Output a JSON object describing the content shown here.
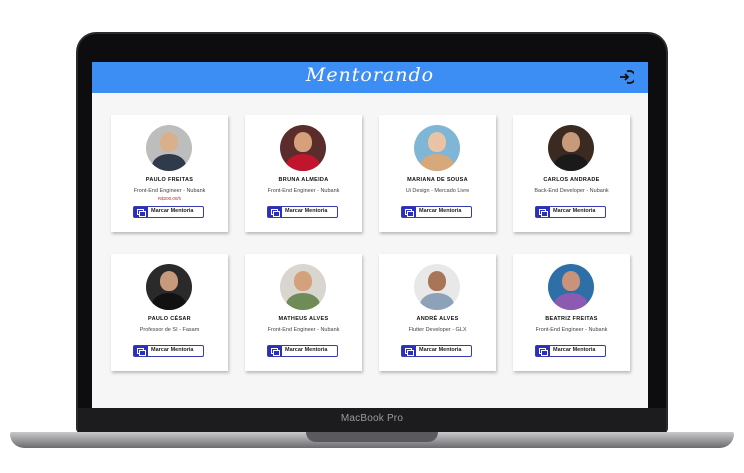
{
  "device": {
    "label": "MacBook Pro"
  },
  "app": {
    "title": "Mentorando"
  },
  "mentors": [
    {
      "name": "PAULO FREITAS",
      "role": "Front-End Engineer - Nubank",
      "price": "R$200,00/h",
      "button": "Marcar Mentoria",
      "bg": "#bdbdbd",
      "skin": "#d9b08c",
      "shirt": "#2f3a4a"
    },
    {
      "name": "BRUNA ALMEIDA",
      "role": "Front-End Engineer - Nubank",
      "button": "Marcar Mentoria",
      "bg": "#5b2c2c",
      "skin": "#d6a07a",
      "shirt": "#c0152c"
    },
    {
      "name": "MARIANA DE SOUSA",
      "role": "Ui Design - Mercado Livre",
      "button": "Marcar Mentoria",
      "bg": "#7fb6d6",
      "skin": "#e9c3a3",
      "shirt": "#d7a97a"
    },
    {
      "name": "CARLOS ANDRADE",
      "role": "Back-End Developer - Nubank",
      "button": "Marcar Mentoria",
      "bg": "#3b2a22",
      "skin": "#c79a7a",
      "shirt": "#1a1a1a"
    },
    {
      "name": "PAULO CÉSAR",
      "role": "Professor de SI - Fasam",
      "button": "Marcar Mentoria",
      "bg": "#2a2a2a",
      "skin": "#c89a7c",
      "shirt": "#111111"
    },
    {
      "name": "MATHEUS ALVES",
      "role": "Front-End Engineer - Nubank",
      "button": "Marcar Mentoria",
      "bg": "#d9d5cf",
      "skin": "#d4a17d",
      "shirt": "#6f8b57"
    },
    {
      "name": "ANDRÉ ALVES",
      "role": "Flutter Developer - GLX",
      "button": "Marcar Mentoria",
      "bg": "#e8e8e8",
      "skin": "#a87558",
      "shirt": "#8da1b8"
    },
    {
      "name": "BEATRIZ FREITAS",
      "role": "Front-End Engineer - Nubank",
      "button": "Marcar Mentoria",
      "bg": "#2d6fa6",
      "skin": "#c9927a",
      "shirt": "#8d5ab1"
    }
  ]
}
